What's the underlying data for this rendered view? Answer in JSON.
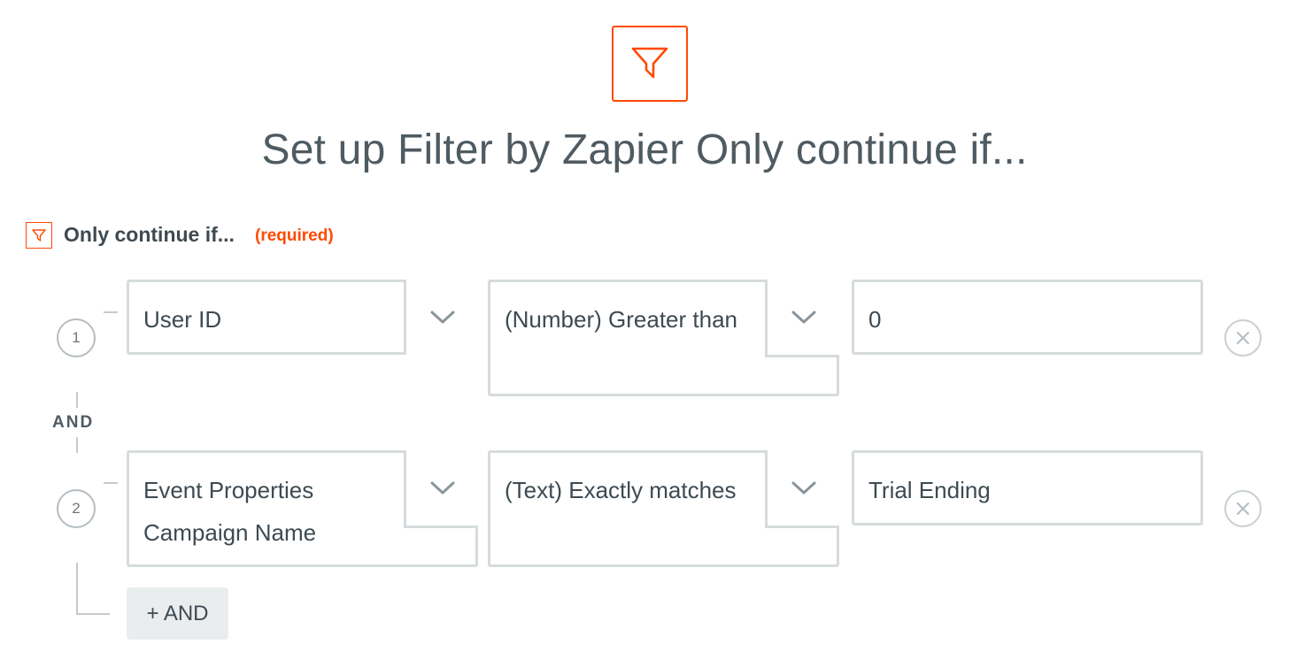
{
  "header": {
    "icon": "filter-icon",
    "title": "Set up Filter by Zapier Only continue if..."
  },
  "section": {
    "icon": "filter-icon",
    "label": "Only continue if...",
    "required": "(required)"
  },
  "rules": [
    {
      "number": "1",
      "field": "User ID",
      "condition": "(Number) Greater than",
      "value": "0"
    },
    {
      "number": "2",
      "field": "Event Properties Campaign Name",
      "condition": "(Text) Exactly matches",
      "value": "Trial Ending"
    }
  ],
  "connector": "AND",
  "add_button": "+ AND",
  "colors": {
    "accent": "#ff4a00",
    "border": "#d6dbdd",
    "text": "#3d4a52"
  }
}
